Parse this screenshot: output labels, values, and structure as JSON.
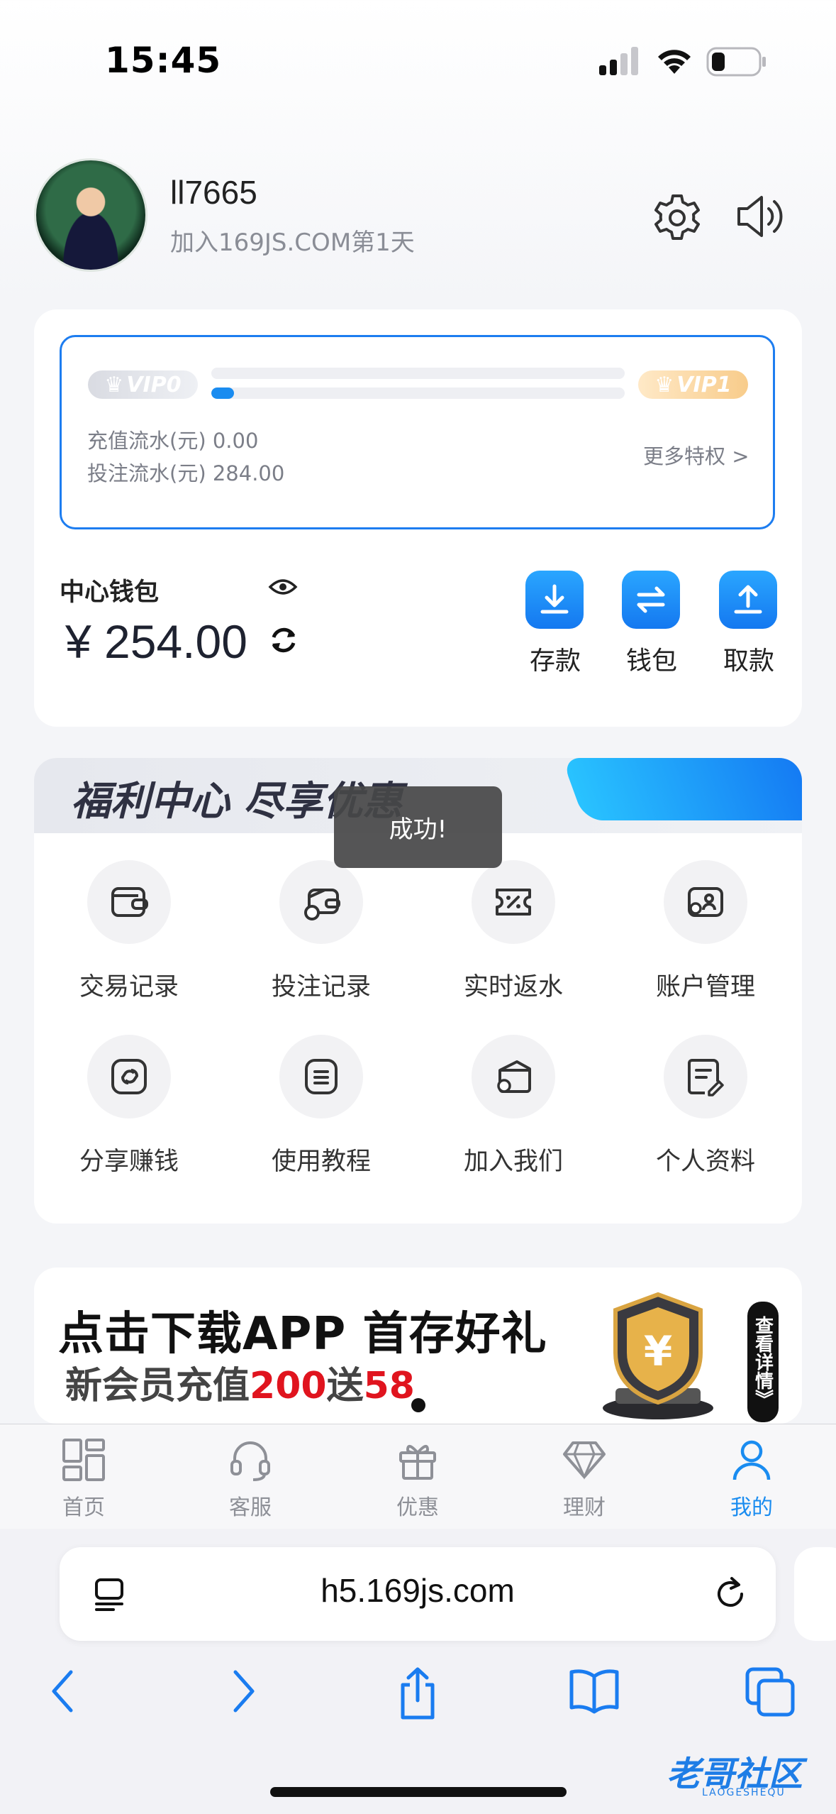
{
  "status": {
    "time": "15:45"
  },
  "profile": {
    "username": "ll7665",
    "join_text": "加入169JS.COM第1天"
  },
  "vip": {
    "current": "VIP0",
    "next": "VIP1",
    "progress": 0.055,
    "recharge_flow": "充值流水(元) 0.00",
    "bet_flow": "投注流水(元) 284.00",
    "more_privileges": "更多特权 >"
  },
  "wallet": {
    "title": "中心钱包",
    "balance": "¥ 254.00",
    "actions": [
      {
        "label": "存款",
        "icon": "download-icon"
      },
      {
        "label": "钱包",
        "icon": "transfer-icon"
      },
      {
        "label": "取款",
        "icon": "upload-icon"
      }
    ]
  },
  "welfare": {
    "title": "福利中心 尽享优惠",
    "items": [
      {
        "label": "交易记录",
        "icon": "wallet-icon"
      },
      {
        "label": "投注记录",
        "icon": "bet-record-icon"
      },
      {
        "label": "实时返水",
        "icon": "coupon-icon"
      },
      {
        "label": "账户管理",
        "icon": "account-card-icon"
      },
      {
        "label": "分享赚钱",
        "icon": "share-icon"
      },
      {
        "label": "使用教程",
        "icon": "tutorial-icon"
      },
      {
        "label": "加入我们",
        "icon": "join-bag-icon"
      },
      {
        "label": "个人资料",
        "icon": "profile-doc-icon"
      }
    ]
  },
  "toast": "成功!",
  "banner": {
    "title": "点击下载APP 首存好礼",
    "sub_prefix": "新会员充值",
    "sub_amount1": "200",
    "sub_mid": "送",
    "sub_amount2": "58",
    "detail": "查看详情》"
  },
  "tabbar": [
    {
      "label": "首页",
      "icon": "home-grid-icon",
      "active": false
    },
    {
      "label": "客服",
      "icon": "headset-icon",
      "active": false
    },
    {
      "label": "优惠",
      "icon": "gift-icon",
      "active": false
    },
    {
      "label": "理财",
      "icon": "diamond-icon",
      "active": false
    },
    {
      "label": "我的",
      "icon": "person-icon",
      "active": true
    }
  ],
  "browser": {
    "url": "h5.169js.com"
  },
  "watermark": {
    "text": "老哥社区",
    "sub": "LAOGESHEQU"
  },
  "colors": {
    "accent": "#1a8cf0",
    "toast_bg": "#464648",
    "red": "#e0141e"
  }
}
